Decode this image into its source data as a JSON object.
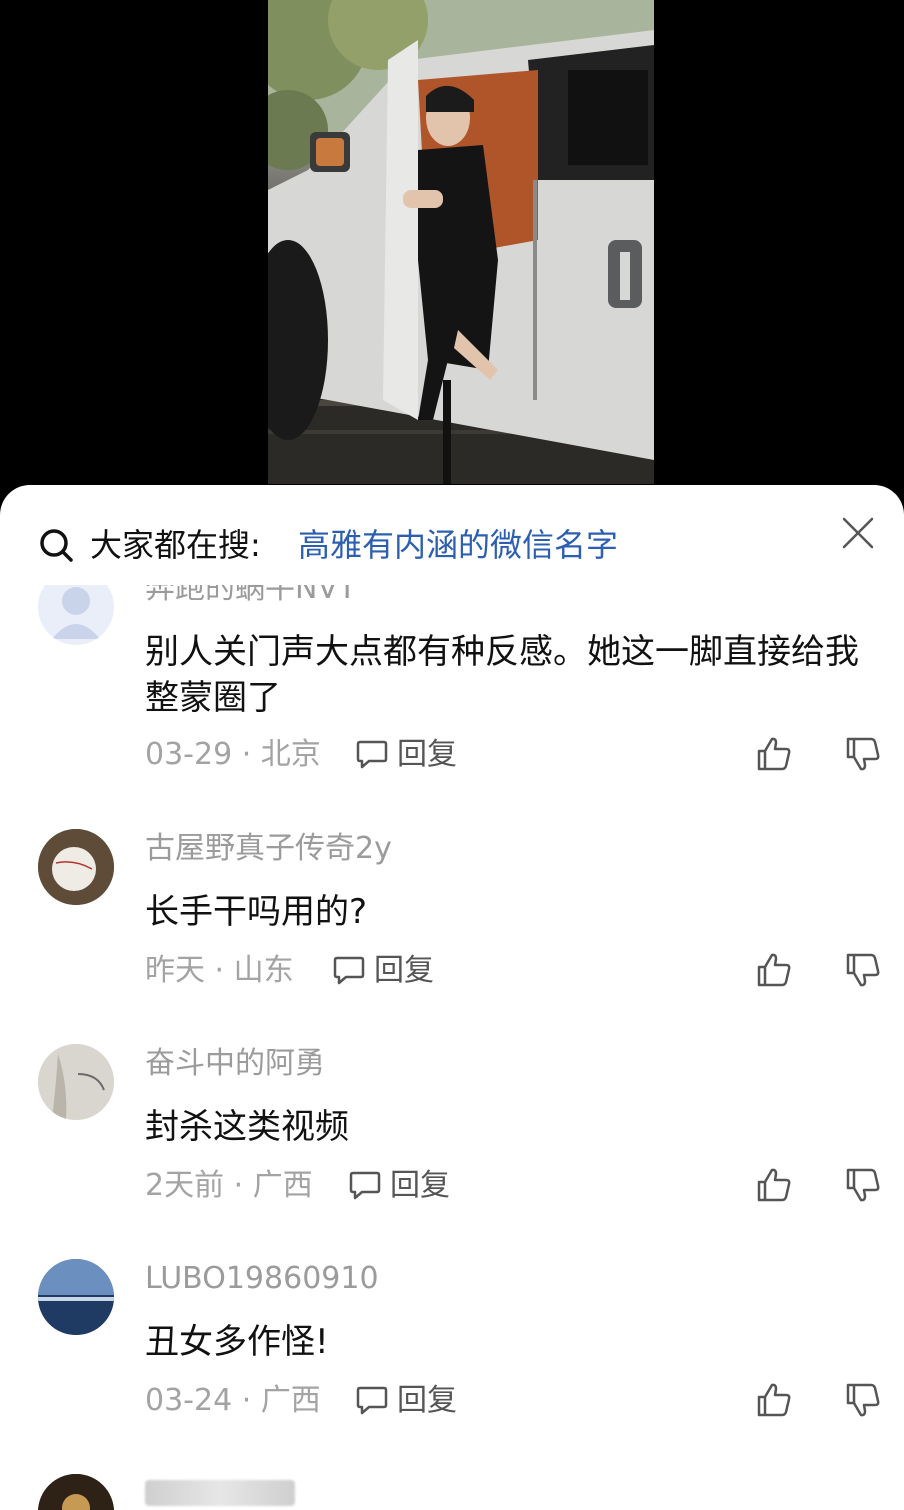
{
  "search": {
    "label": "大家都在搜:",
    "term": "高雅有内涵的微信名字"
  },
  "comments": [
    {
      "username": "奔跑的蜗牛NVT",
      "text": "别人关门声大点都有种反感。她这一脚直接给我整蒙圈了",
      "time_location": "03-29 · 北京",
      "reply_label": "回复"
    },
    {
      "username": "古屋野真子传奇2y",
      "text": "长手干吗用的?",
      "time_location": "昨天 · 山东",
      "reply_label": "回复"
    },
    {
      "username": "奋斗中的阿勇",
      "text": "封杀这类视频",
      "time_location": "2天前 · 广西",
      "reply_label": "回复"
    },
    {
      "username": "LUBO19860910",
      "text": "丑女多作怪!",
      "time_location": "03-24 · 广西",
      "reply_label": "回复"
    }
  ],
  "colors": {
    "search_term": "#2d5fb0",
    "meta_text": "#a3a3a3",
    "username_text": "#9b9b9b"
  }
}
